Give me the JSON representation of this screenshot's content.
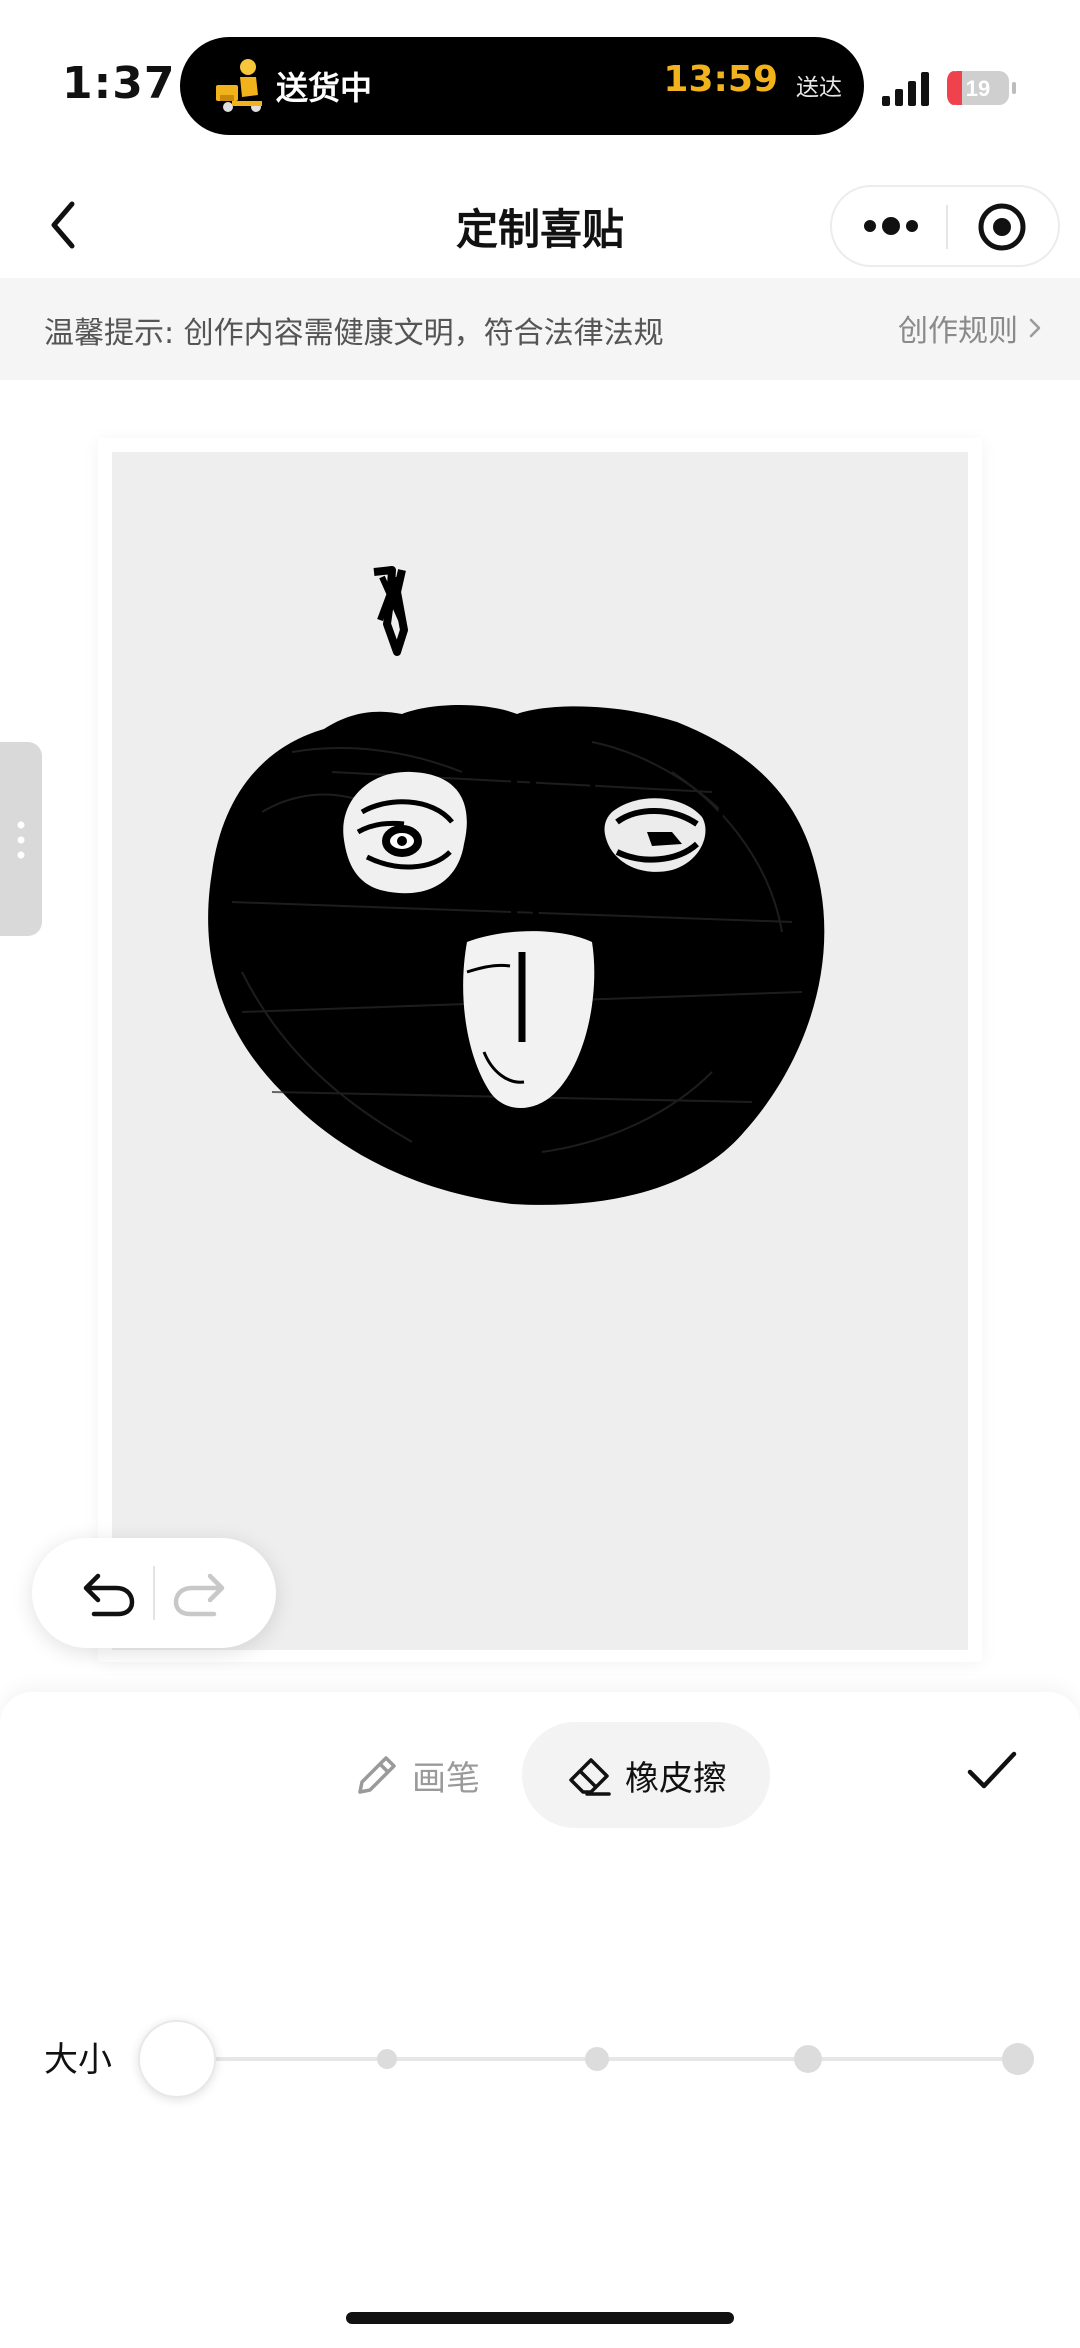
{
  "status_bar": {
    "time": "1:37",
    "live_activity": {
      "status": "送货中",
      "eta_time": "13:59",
      "eta_label": "送达",
      "icon": "delivery-courier-icon"
    },
    "signal_icon": "cellular-signal-icon",
    "battery_level": "19",
    "battery_color": "#f0424c"
  },
  "nav": {
    "title": "定制喜贴",
    "back_icon": "chevron-left-icon",
    "more_icon": "more-dots-icon",
    "close_icon": "target-circle-icon"
  },
  "tip": {
    "text": "温馨提示: 创作内容需健康文明，符合法律法规",
    "link_label": "创作规则"
  },
  "canvas": {
    "drawing": "apple-face-sketch",
    "history": {
      "undo_icon": "undo-icon",
      "redo_icon": "redo-icon",
      "redo_enabled": false
    }
  },
  "tools": {
    "pen_label": "画笔",
    "eraser_label": "橡皮擦",
    "active_tool": "eraser",
    "confirm_icon": "checkmark-icon",
    "size_label": "大小",
    "size_steps": 5,
    "size_selected_index": 0
  }
}
